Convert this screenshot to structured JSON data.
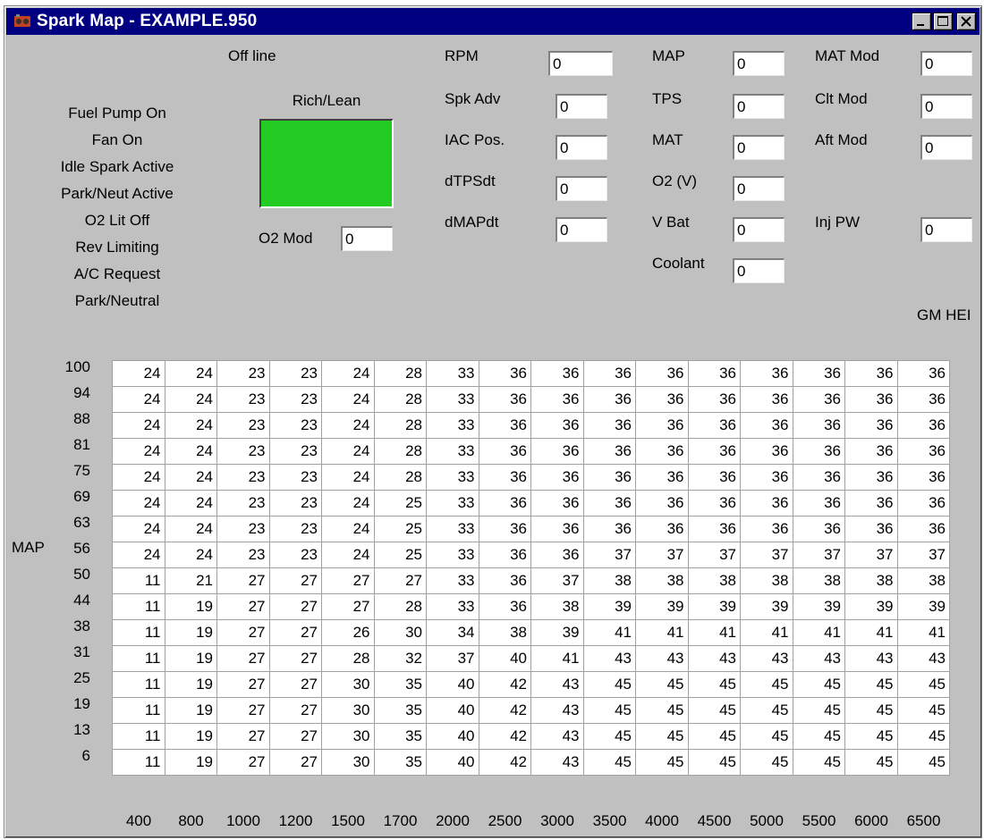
{
  "window": {
    "title": "Spark Map - EXAMPLE.950",
    "minimize_label": "_",
    "maximize_label": "□",
    "close_label": "×"
  },
  "status": {
    "connection": "Off line",
    "rich_lean_label": "Rich/Lean",
    "rich_lean_color": "#22cc22",
    "o2_mod_label": "O2 Mod",
    "o2_mod_value": "0",
    "ignition": "GM HEI"
  },
  "indicators": [
    "Fuel Pump On",
    "Fan On",
    "Idle Spark Active",
    "Park/Neut Active",
    "O2 Lit Off",
    "Rev Limiting",
    "A/C Request",
    "Park/Neutral"
  ],
  "gauges": {
    "col1": [
      {
        "label": "RPM",
        "value": "0"
      },
      {
        "label": "Spk Adv",
        "value": "0"
      },
      {
        "label": "IAC Pos.",
        "value": "0"
      },
      {
        "label": "dTPSdt",
        "value": "0"
      },
      {
        "label": "dMAPdt",
        "value": "0"
      }
    ],
    "col2": [
      {
        "label": "MAP",
        "value": "0"
      },
      {
        "label": "TPS",
        "value": "0"
      },
      {
        "label": "MAT",
        "value": "0"
      },
      {
        "label": "O2 (V)",
        "value": "0"
      },
      {
        "label": "V Bat",
        "value": "0"
      },
      {
        "label": "Coolant",
        "value": "0"
      }
    ],
    "col3": [
      {
        "label": "MAT Mod",
        "value": "0"
      },
      {
        "label": "Clt Mod",
        "value": "0"
      },
      {
        "label": "Aft Mod",
        "value": "0"
      },
      {
        "label": "Inj PW",
        "value": "0"
      }
    ]
  },
  "table": {
    "y_axis_label": "MAP",
    "map_rows": [
      "100",
      "94",
      "88",
      "81",
      "75",
      "69",
      "63",
      "56",
      "50",
      "44",
      "38",
      "31",
      "25",
      "19",
      "13",
      "6"
    ],
    "rpm_cols": [
      "400",
      "800",
      "1000",
      "1200",
      "1500",
      "1700",
      "2000",
      "2500",
      "3000",
      "3500",
      "4000",
      "4500",
      "5000",
      "5500",
      "6000",
      "6500"
    ],
    "values": [
      [
        24,
        24,
        23,
        23,
        24,
        28,
        33,
        36,
        36,
        36,
        36,
        36,
        36,
        36,
        36,
        36
      ],
      [
        24,
        24,
        23,
        23,
        24,
        28,
        33,
        36,
        36,
        36,
        36,
        36,
        36,
        36,
        36,
        36
      ],
      [
        24,
        24,
        23,
        23,
        24,
        28,
        33,
        36,
        36,
        36,
        36,
        36,
        36,
        36,
        36,
        36
      ],
      [
        24,
        24,
        23,
        23,
        24,
        28,
        33,
        36,
        36,
        36,
        36,
        36,
        36,
        36,
        36,
        36
      ],
      [
        24,
        24,
        23,
        23,
        24,
        28,
        33,
        36,
        36,
        36,
        36,
        36,
        36,
        36,
        36,
        36
      ],
      [
        24,
        24,
        23,
        23,
        24,
        25,
        33,
        36,
        36,
        36,
        36,
        36,
        36,
        36,
        36,
        36
      ],
      [
        24,
        24,
        23,
        23,
        24,
        25,
        33,
        36,
        36,
        36,
        36,
        36,
        36,
        36,
        36,
        36
      ],
      [
        24,
        24,
        23,
        23,
        24,
        25,
        33,
        36,
        36,
        37,
        37,
        37,
        37,
        37,
        37,
        37
      ],
      [
        11,
        21,
        27,
        27,
        27,
        27,
        33,
        36,
        37,
        38,
        38,
        38,
        38,
        38,
        38,
        38
      ],
      [
        11,
        19,
        27,
        27,
        27,
        28,
        33,
        36,
        38,
        39,
        39,
        39,
        39,
        39,
        39,
        39
      ],
      [
        11,
        19,
        27,
        27,
        26,
        30,
        34,
        38,
        39,
        41,
        41,
        41,
        41,
        41,
        41,
        41
      ],
      [
        11,
        19,
        27,
        27,
        28,
        32,
        37,
        40,
        41,
        43,
        43,
        43,
        43,
        43,
        43,
        43
      ],
      [
        11,
        19,
        27,
        27,
        30,
        35,
        40,
        42,
        43,
        45,
        45,
        45,
        45,
        45,
        45,
        45
      ],
      [
        11,
        19,
        27,
        27,
        30,
        35,
        40,
        42,
        43,
        45,
        45,
        45,
        45,
        45,
        45,
        45
      ],
      [
        11,
        19,
        27,
        27,
        30,
        35,
        40,
        42,
        43,
        45,
        45,
        45,
        45,
        45,
        45,
        45
      ],
      [
        11,
        19,
        27,
        27,
        30,
        35,
        40,
        42,
        43,
        45,
        45,
        45,
        45,
        45,
        45,
        45
      ]
    ]
  }
}
